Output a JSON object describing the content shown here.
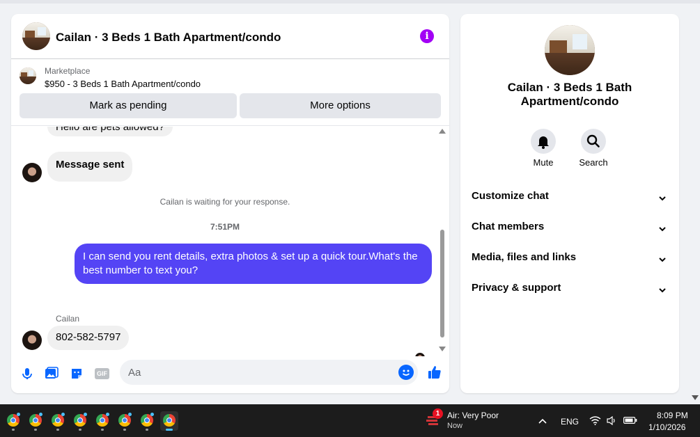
{
  "chat": {
    "title": "Cailan · 3 Beds 1 Bath Apartment/condo",
    "marketplace_label": "Marketplace",
    "listing": "$950 - 3 Beds 1 Bath Apartment/condo",
    "mark_pending": "Mark as pending",
    "more_options": "More options",
    "messages": {
      "partial_top": "Hello are pets allowed?",
      "sent_notice": "Message sent",
      "waiting": "Cailan is waiting for your response.",
      "time": "7:51PM",
      "outgoing": "I can send you rent details, extra photos & set up a quick tour.What's the best number to text you?",
      "sender_name": "Cailan",
      "incoming": "802-582-5797"
    },
    "composer_placeholder": "Aa",
    "gif_label": "GIF"
  },
  "side": {
    "title": "Cailan · 3 Beds 1 Bath Apartment/condo",
    "mute": "Mute",
    "search": "Search",
    "sections": [
      "Customize chat",
      "Chat members",
      "Media, files and links",
      "Privacy & support"
    ]
  },
  "taskbar": {
    "weather_count": "1",
    "weather_title": "Air: Very Poor",
    "weather_sub": "Now",
    "lang": "ENG",
    "time": "8:09 PM",
    "date": "1/10/2026"
  },
  "colors": {
    "accent": "#0866ff",
    "outgoing_bubble": "#5444f5",
    "info": "#a200f5"
  }
}
